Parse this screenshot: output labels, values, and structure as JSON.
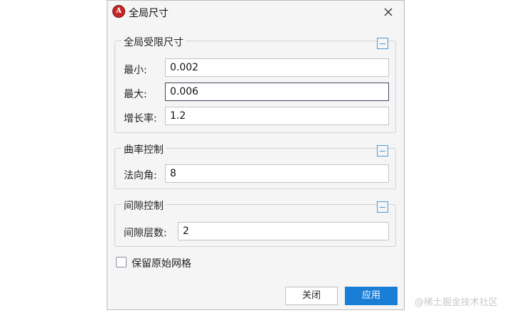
{
  "window": {
    "title": "全局尺寸",
    "app_icon_text": "A"
  },
  "groups": {
    "global_size": {
      "label": "全局受限尺寸",
      "fields": {
        "min": {
          "label": "最小:",
          "value": "0.002"
        },
        "max": {
          "label": "最大:",
          "value": "0.006"
        },
        "growth": {
          "label": "增长率:",
          "value": "1.2"
        }
      }
    },
    "curvature": {
      "label": "曲率控制",
      "fields": {
        "normal_angle": {
          "label": "法向角:",
          "value": "8"
        }
      }
    },
    "gap": {
      "label": "间隙控制",
      "fields": {
        "layers": {
          "label": "间隙层数:",
          "value": "2"
        }
      }
    }
  },
  "options": {
    "keep_original_mesh": {
      "label": "保留原始网格",
      "checked": false
    }
  },
  "buttons": {
    "close": "关闭",
    "apply": "应用"
  },
  "watermark": "@稀土掘金技术社区",
  "colors": {
    "accent": "#1a7dd6",
    "collapse_icon": "#4a9fd8",
    "app_icon": "#c62828"
  }
}
